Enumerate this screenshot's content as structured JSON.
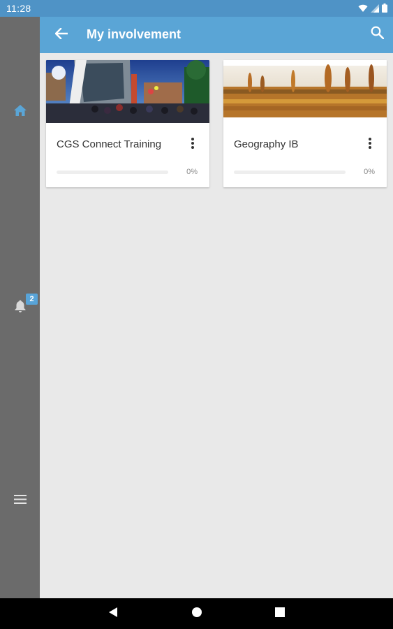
{
  "status_bar": {
    "time": "11:28",
    "icons": [
      "wifi-icon",
      "signal-icon",
      "battery-icon"
    ]
  },
  "app_bar": {
    "title": "My involvement",
    "back_icon": "arrow-back-icon",
    "search_icon": "search-icon"
  },
  "side_nav": {
    "items": [
      {
        "name": "home",
        "icon": "home-icon",
        "active": true
      },
      {
        "name": "notifications",
        "icon": "bell-icon",
        "badge": "2"
      },
      {
        "name": "menu",
        "icon": "hamburger-menu-icon"
      }
    ]
  },
  "cards": [
    {
      "title": "CGS Connect Training",
      "progress_label": "0%",
      "progress": 0,
      "image": "school-building-photo"
    },
    {
      "title": "Geography IB",
      "progress_label": "0%",
      "progress": 0,
      "image": "vineyard-photo"
    }
  ],
  "colors": {
    "status_bar": "#4f93c6",
    "app_bar": "#5aa5d6",
    "rail": "#6b6b6b",
    "accent": "#58a4d8",
    "background": "#e9e9e9"
  }
}
